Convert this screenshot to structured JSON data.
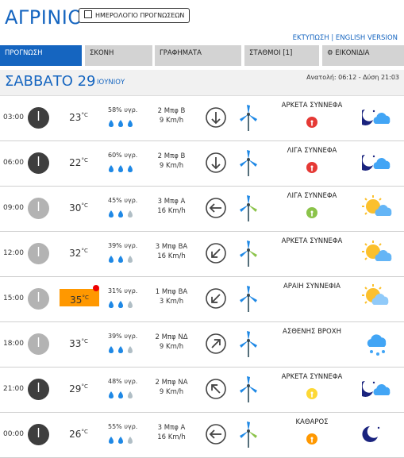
{
  "header": {
    "city": "ΑΓΡΙΝΙΟ",
    "calendar_button": "ΗΜΕΡΟΛΟΓΙΟ ΠΡΟΓΝΩΣΕΩΝ",
    "print_link": "ΕΚΤΥΠΩΣΗ",
    "separator": "|",
    "english_link": "ENGLISH VERSION"
  },
  "tabs": [
    {
      "label": "ΠΡΟΓΝΩΣΗ",
      "active": true
    },
    {
      "label": "ΣΚΟΝΗ",
      "active": false
    },
    {
      "label": "ΓΡΑΦΗΜΑΤΑ",
      "active": false
    },
    {
      "label": "ΣΤΑΘΜΟΙ [1]",
      "active": false
    },
    {
      "label": "ΕΙΚΟΝΙΔΙΑ",
      "icon": "gear-icon",
      "active": false
    }
  ],
  "day": {
    "name": "ΣΑΒΒΑΤΟ 29",
    "month": "ΙΟΥΝΙΟΥ",
    "sun_times": "Ανατολή: 06:12 - Δύση 21:03"
  },
  "colors": {
    "accent": "#1565c0",
    "tab_inactive": "#d3d3d3",
    "hot": "#ff9800",
    "warn_red": "#e53935",
    "warn_green": "#8bc34a",
    "warn_yellow": "#fdd835",
    "warn_orange": "#ff9800"
  },
  "forecast": [
    {
      "time": "03:00",
      "clock": "dark",
      "temp": "23",
      "unit": "°C",
      "humidity": "58% υγρ.",
      "drops": 3,
      "wind_force": "2 Μπφ Β",
      "wind_speed": "9 Km/h",
      "direction": "Β",
      "condition": "ΑΡΚΕΤΑ ΣΥΝΝΕΦΑ",
      "warning": "red",
      "weather_icon": "moon-cloud-icon"
    },
    {
      "time": "06:00",
      "clock": "dark",
      "temp": "22",
      "unit": "°C",
      "humidity": "60% υγρ.",
      "drops": 3,
      "wind_force": "2 Μπφ Β",
      "wind_speed": "9 Km/h",
      "direction": "Β",
      "condition": "ΛΙΓΑ ΣΥΝΝΕΦΑ",
      "warning": "red",
      "weather_icon": "moon-cloud-icon"
    },
    {
      "time": "09:00",
      "clock": "light",
      "temp": "30",
      "unit": "°C",
      "humidity": "45% υγρ.",
      "drops": 2,
      "wind_force": "3 Μπφ Α",
      "wind_speed": "16 Km/h",
      "direction": "Α",
      "condition": "ΛΙΓΑ ΣΥΝΝΕΦΑ",
      "warning": "green",
      "weather_icon": "sun-cloud-icon"
    },
    {
      "time": "12:00",
      "clock": "light",
      "temp": "32",
      "unit": "°C",
      "humidity": "39% υγρ.",
      "drops": 2,
      "wind_force": "3 Μπφ ΒΑ",
      "wind_speed": "16 Km/h",
      "direction": "ΒΑ",
      "condition": "ΑΡΚΕΤΑ ΣΥΝΝΕΦΑ",
      "warning": "",
      "weather_icon": "sun-cloud-icon"
    },
    {
      "time": "15:00",
      "clock": "light",
      "temp": "35",
      "unit": "°C",
      "humidity": "31% υγρ.",
      "drops": 2,
      "wind_force": "1 Μπφ ΒΑ",
      "wind_speed": "3 Km/h",
      "direction": "ΒΑ",
      "condition": "ΑΡΑΙΗ ΣΥΝΝΕΦΙΑ",
      "warning": "",
      "weather_icon": "sun-haze-icon",
      "hot": true
    },
    {
      "time": "18:00",
      "clock": "light",
      "temp": "33",
      "unit": "°C",
      "humidity": "39% υγρ.",
      "drops": 2,
      "wind_force": "2 Μπφ ΝΔ",
      "wind_speed": "9 Km/h",
      "direction": "ΝΔ",
      "condition": "ΑΣΘΕΝΗΣ ΒΡΟΧΗ",
      "warning": "",
      "weather_icon": "rain-cloud-icon"
    },
    {
      "time": "21:00",
      "clock": "dark",
      "temp": "29",
      "unit": "°C",
      "humidity": "48% υγρ.",
      "drops": 2,
      "wind_force": "2 Μπφ ΝΑ",
      "wind_speed": "9 Km/h",
      "direction": "ΝΑ",
      "condition": "ΑΡΚΕΤΑ ΣΥΝΝΕΦΑ",
      "warning": "yellow",
      "weather_icon": "moon-cloud-icon"
    },
    {
      "time": "00:00",
      "clock": "dark",
      "temp": "26",
      "unit": "°C",
      "humidity": "55% υγρ.",
      "drops": 2,
      "wind_force": "3 Μπφ Α",
      "wind_speed": "16 Km/h",
      "direction": "Α",
      "condition": "ΚΑΘΑΡΟΣ",
      "warning": "orange",
      "weather_icon": "moon-icon"
    }
  ]
}
